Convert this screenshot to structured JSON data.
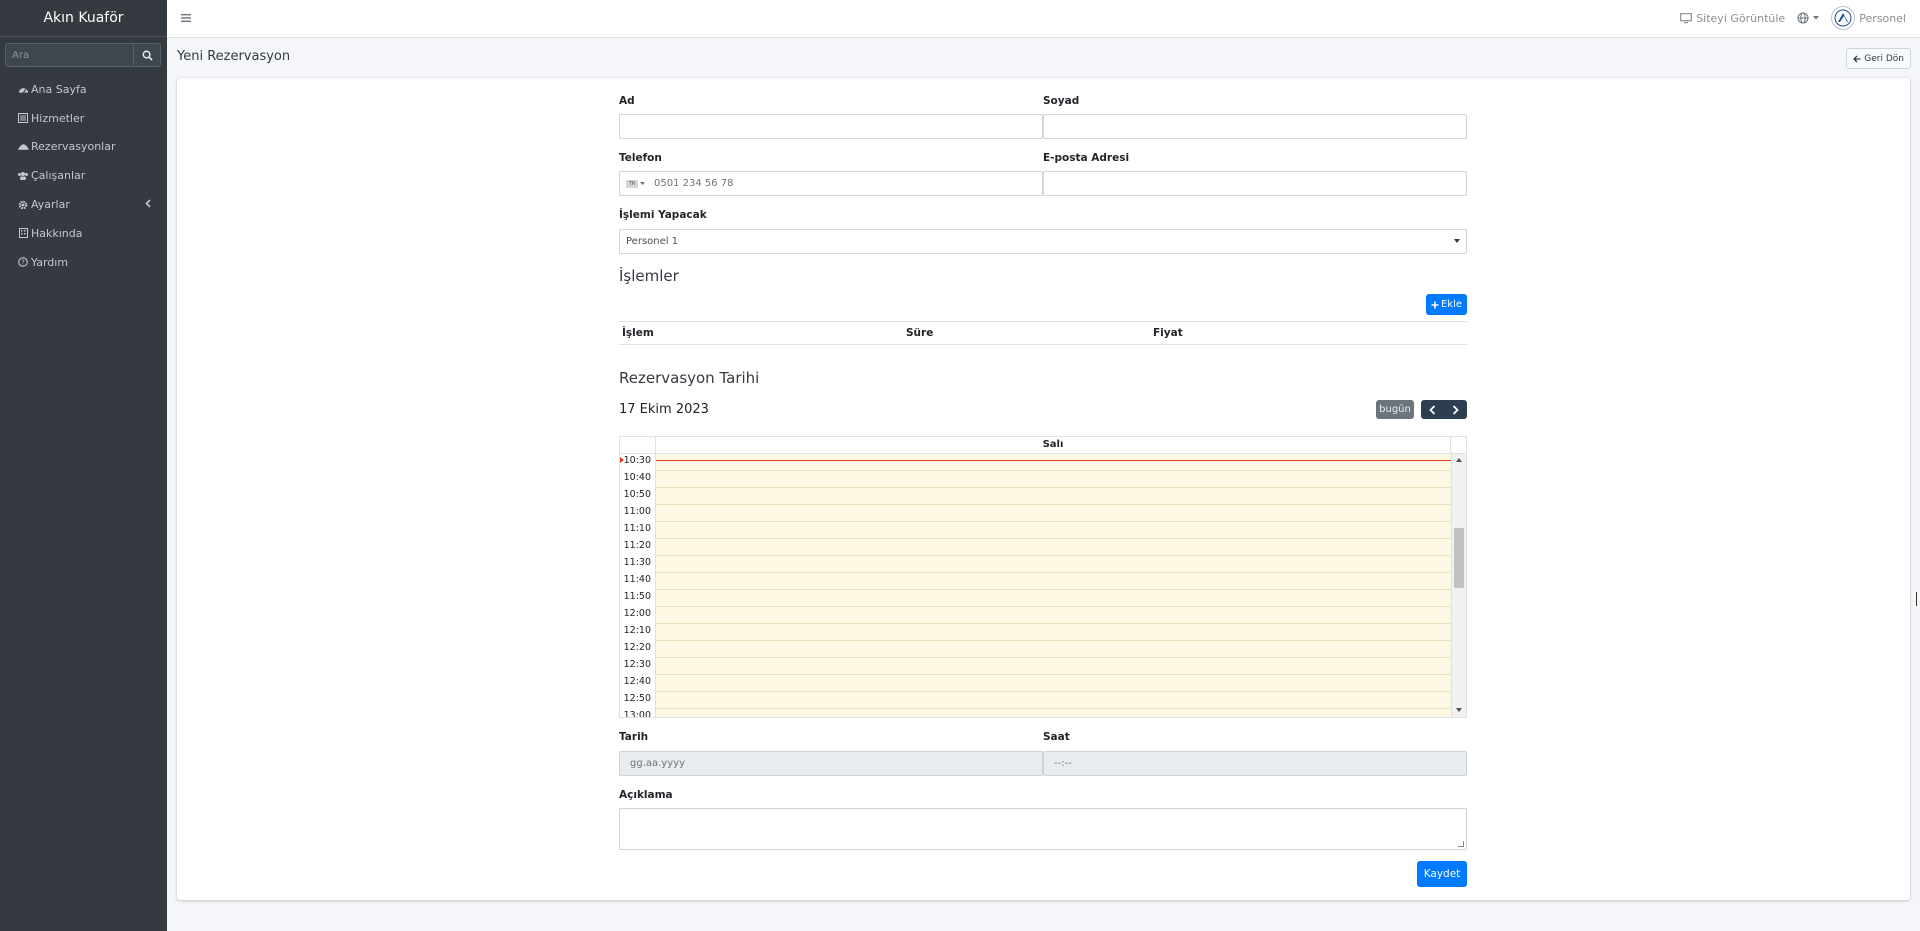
{
  "sidebar": {
    "brand": "Akın Kuaför",
    "search": {
      "placeholder": "Ara",
      "value": ""
    },
    "items": [
      {
        "label": "Ana Sayfa",
        "icon": "dashboard-icon"
      },
      {
        "label": "Hizmetler",
        "icon": "list-icon"
      },
      {
        "label": "Rezervasyonlar",
        "icon": "umbrella-icon"
      },
      {
        "label": "Çalışanlar",
        "icon": "users-icon"
      },
      {
        "label": "Ayarlar",
        "icon": "gear-icon"
      },
      {
        "label": "Hakkında",
        "icon": "building-icon"
      },
      {
        "label": "Yardım",
        "icon": "help-circle-icon"
      }
    ]
  },
  "topbar": {
    "view_site": "Siteyi Görüntüle",
    "user": "Personel"
  },
  "page": {
    "title": "Yeni Rezervasyon",
    "back": "Geri Dön"
  },
  "form": {
    "first_name": {
      "label": "Ad",
      "value": ""
    },
    "last_name": {
      "label": "Soyad",
      "value": ""
    },
    "phone": {
      "label": "Telefon",
      "country": "TR",
      "placeholder": "0501 234 56 78"
    },
    "email": {
      "label": "E-posta Adresi",
      "value": ""
    },
    "staff": {
      "label": "İşlemi Yapacak",
      "value": "Personel 1"
    },
    "services_title": "İşlemler",
    "add": "Ekle",
    "columns": [
      "İşlem",
      "Süre",
      "Fiyat"
    ],
    "reservation_title": "Rezervasyon Tarihi",
    "calendar": {
      "title": "17 Ekim 2023",
      "today": "bugün",
      "day": "Salı",
      "slots": [
        "10:30",
        "10:40",
        "10:50",
        "11:00",
        "11:10",
        "11:20",
        "11:30",
        "11:40",
        "11:50",
        "12:00",
        "12:10",
        "12:20",
        "12:30",
        "12:40",
        "12:50",
        "13:00"
      ]
    },
    "date": {
      "label": "Tarih",
      "placeholder": "gg.aa.yyyy"
    },
    "time": {
      "label": "Saat",
      "placeholder": "--:--"
    },
    "note": {
      "label": "Açıklama",
      "value": ""
    },
    "save": "Kaydet"
  },
  "colors": {
    "sidebar": "#343a40",
    "primary": "#007bff",
    "slot": "#fcf8e3",
    "now": "#e03d1d"
  }
}
